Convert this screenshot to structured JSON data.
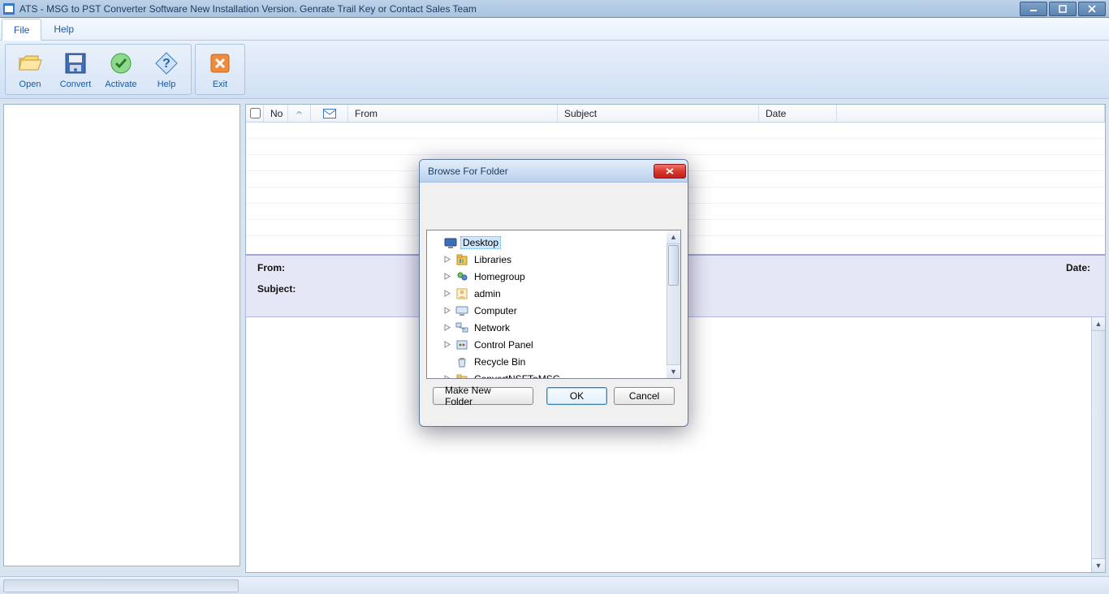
{
  "window": {
    "title": "ATS - MSG to PST Converter Software New Installation Version. Genrate Trail Key or Contact Sales Team"
  },
  "menu": {
    "items": [
      {
        "label": "File",
        "active": true
      },
      {
        "label": "Help",
        "active": false
      }
    ]
  },
  "toolbar": {
    "open": "Open",
    "convert": "Convert",
    "activate": "Activate",
    "help": "Help",
    "exit": "Exit"
  },
  "grid": {
    "columns": {
      "no": "No",
      "attach": "📎",
      "envelope": "✉",
      "from": "From",
      "subject": "Subject",
      "date": "Date"
    }
  },
  "details": {
    "from_label": "From:",
    "subject_label": "Subject:",
    "date_label": "Date:",
    "from_value": "",
    "subject_value": "",
    "date_value": ""
  },
  "dialog": {
    "title": "Browse For Folder",
    "tree": [
      {
        "label": "Desktop",
        "icon": "desktop",
        "expandable": false,
        "selected": true,
        "indent": 0
      },
      {
        "label": "Libraries",
        "icon": "libraries",
        "expandable": true,
        "indent": 1
      },
      {
        "label": "Homegroup",
        "icon": "homegroup",
        "expandable": true,
        "indent": 1
      },
      {
        "label": "admin",
        "icon": "user",
        "expandable": true,
        "indent": 1
      },
      {
        "label": "Computer",
        "icon": "computer",
        "expandable": true,
        "indent": 1
      },
      {
        "label": "Network",
        "icon": "network",
        "expandable": true,
        "indent": 1
      },
      {
        "label": "Control Panel",
        "icon": "controlpanel",
        "expandable": true,
        "indent": 1
      },
      {
        "label": "Recycle Bin",
        "icon": "recycle",
        "expandable": false,
        "indent": 1
      },
      {
        "label": "ConvertNSFToMSG",
        "icon": "folder",
        "expandable": true,
        "indent": 1
      }
    ],
    "buttons": {
      "make_new_folder": "Make New Folder",
      "ok": "OK",
      "cancel": "Cancel"
    }
  }
}
